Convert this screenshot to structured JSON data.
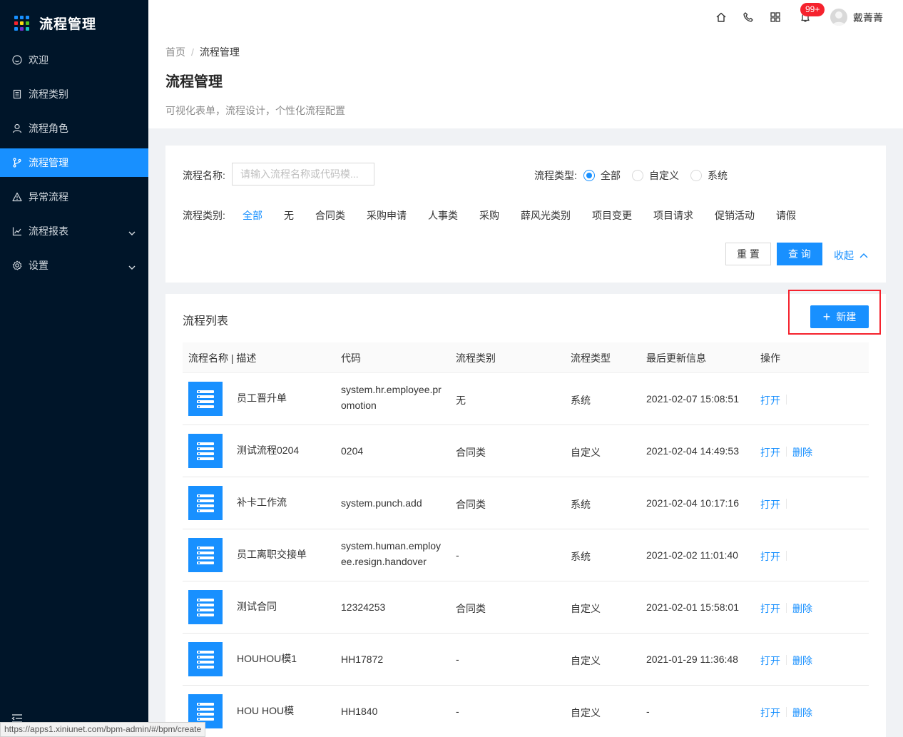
{
  "app": {
    "title": "流程管理",
    "logo_colors": [
      "#1890ff",
      "#1890ff",
      "#1890ff",
      "#f5222d",
      "#fadb14",
      "#52c41a",
      "#1890ff",
      "#722ed1",
      "#13c2c2"
    ]
  },
  "sidebar": {
    "items": [
      {
        "label": "欢迎",
        "icon": "smile-icon",
        "active": false
      },
      {
        "label": "流程类别",
        "icon": "book-icon",
        "active": false
      },
      {
        "label": "流程角色",
        "icon": "user-icon",
        "active": false
      },
      {
        "label": "流程管理",
        "icon": "branch-icon",
        "active": true
      },
      {
        "label": "异常流程",
        "icon": "warning-icon",
        "active": false
      },
      {
        "label": "流程报表",
        "icon": "line-chart-icon",
        "active": false,
        "expandable": true
      },
      {
        "label": "设置",
        "icon": "gear-icon",
        "active": false,
        "expandable": true
      }
    ]
  },
  "header": {
    "badge": "99+",
    "username": "戴菁菁"
  },
  "page": {
    "breadcrumb": [
      "首页",
      "流程管理"
    ],
    "breadcrumb_sep": "/",
    "title": "流程管理",
    "description": "可视化表单，流程设计，个性化流程配置"
  },
  "filter": {
    "name_label": "流程名称:",
    "name_placeholder": "请输入流程名称或代码模...",
    "type_label": "流程类型:",
    "type_options": [
      "全部",
      "自定义",
      "系统"
    ],
    "type_selected": "全部",
    "category_label": "流程类别:",
    "categories": [
      "全部",
      "无",
      "合同类",
      "采购申请",
      "人事类",
      "采购",
      "薛风光类别",
      "项目变更",
      "项目请求",
      "促销活动",
      "请假"
    ],
    "category_selected": "全部",
    "reset_label": "重 置",
    "query_label": "查 询",
    "collapse_label": "收起"
  },
  "list": {
    "title": "流程列表",
    "new_label": "新建",
    "columns": [
      "流程名称 | 描述",
      "代码",
      "流程类别",
      "流程类型",
      "最后更新信息",
      "操作"
    ],
    "rows": [
      {
        "name": "员工晋升单",
        "code1": "system.hr.employee.pr",
        "code2": "omotion",
        "category": "无",
        "type": "系统",
        "updated": "2021-02-07 15:08:51",
        "open": "打开",
        "delete": ""
      },
      {
        "name": "测试流程0204",
        "code1": "0204",
        "code2": "",
        "category": "合同类",
        "type": "自定义",
        "updated": "2021-02-04 14:49:53",
        "open": "打开",
        "delete": "删除"
      },
      {
        "name": "补卡工作流",
        "code1": "system.punch.add",
        "code2": "",
        "category": "合同类",
        "type": "系统",
        "updated": "2021-02-04 10:17:16",
        "open": "打开",
        "delete": ""
      },
      {
        "name": "员工离职交接单",
        "code1": "system.human.employ",
        "code2": "ee.resign.handover",
        "category": "-",
        "type": "系统",
        "updated": "2021-02-02 11:01:40",
        "open": "打开",
        "delete": ""
      },
      {
        "name": "测试合同",
        "code1": "12324253",
        "code2": "",
        "category": "合同类",
        "type": "自定义",
        "updated": "2021-02-01 15:58:01",
        "open": "打开",
        "delete": "删除"
      },
      {
        "name": "HOUHOU模1",
        "code1": "HH17872",
        "code2": "",
        "category": "-",
        "type": "自定义",
        "updated": "2021-01-29 11:36:48",
        "open": "打开",
        "delete": "删除"
      },
      {
        "name": "HOU HOU模",
        "code1": "HH1840",
        "code2": "",
        "category": "-",
        "type": "自定义",
        "updated": "-",
        "open": "打开",
        "delete": "删除"
      }
    ]
  },
  "status_url": "https://apps1.xiniunet.com/bpm-admin/#/bpm/create"
}
